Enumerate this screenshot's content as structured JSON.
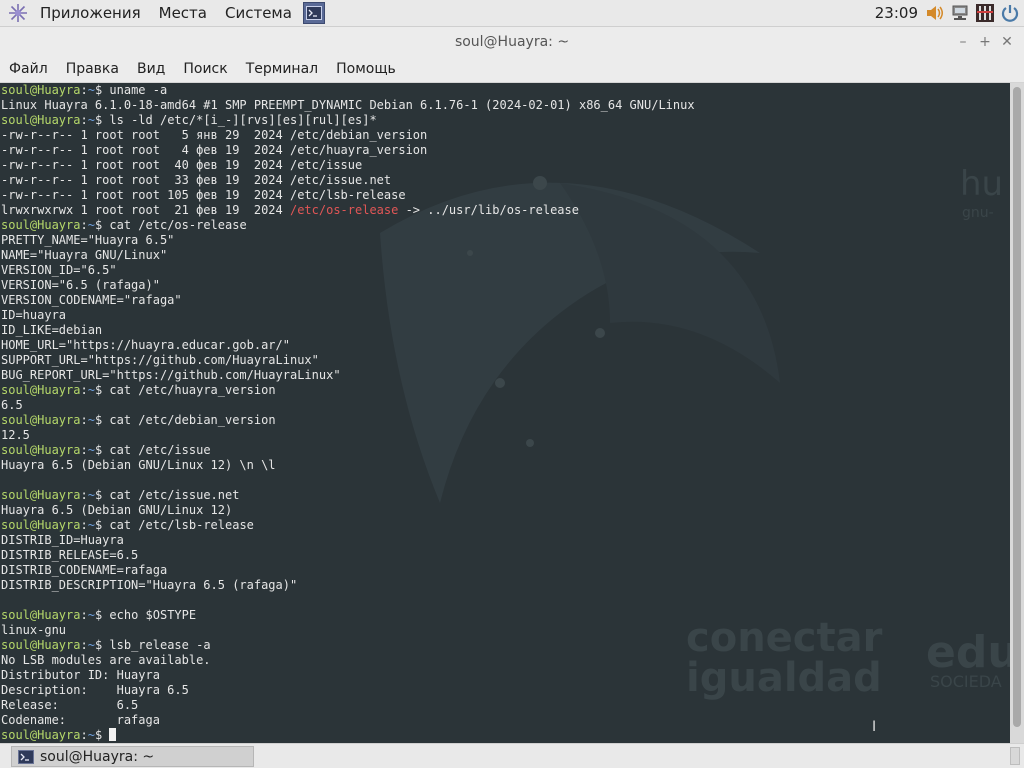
{
  "top_panel": {
    "menus": [
      "Приложения",
      "Места",
      "Система"
    ],
    "clock": "23:09",
    "tray_icons": [
      "volume-icon",
      "network-icon",
      "keyboard-icon",
      "power-icon"
    ]
  },
  "window": {
    "title": "soul@Huayra: ~",
    "controls": [
      "–",
      "+",
      "✕"
    ]
  },
  "menubar": [
    "Файл",
    "Правка",
    "Вид",
    "Поиск",
    "Терминал",
    "Помощь"
  ],
  "wallpaper_text": {
    "brand1": "conectar",
    "brand2": "igualdad",
    "brand3": "edu",
    "brand4": "SOCIEDA",
    "brand5": "hu",
    "brand6": "gnu-"
  },
  "colors": {
    "terminal_bg": "#2b3438",
    "prompt_user": "#b5d86a",
    "prompt_path": "#6fa0e0",
    "symlink": "#e05656"
  },
  "terminal": {
    "prompt_user": "soul@Huayra",
    "prompt_sep": ":",
    "prompt_path": "~",
    "prompt_end": "$ ",
    "lines": [
      {
        "type": "prompt",
        "text": "uname -a"
      },
      {
        "type": "out",
        "text": "Linux Huayra 6.1.0-18-amd64 #1 SMP PREEMPT_DYNAMIC Debian 6.1.76-1 (2024-02-01) x86_64 GNU/Linux"
      },
      {
        "type": "prompt",
        "text": "ls -ld /etc/*[i_-][rvs][es][rul][es]*"
      },
      {
        "type": "out",
        "text": "-rw-r--r-- 1 root root   5 янв 29  2024 /etc/debian_version"
      },
      {
        "type": "out",
        "text": "-rw-r--r-- 1 root root   4 фев 19  2024 /etc/huayra_version"
      },
      {
        "type": "out",
        "text": "-rw-r--r-- 1 root root  40 фев 19  2024 /etc/issue"
      },
      {
        "type": "out",
        "text": "-rw-r--r-- 1 root root  33 фев 19  2024 /etc/issue.net"
      },
      {
        "type": "out",
        "text": "-rw-r--r-- 1 root root 105 фев 19  2024 /etc/lsb-release"
      },
      {
        "type": "link",
        "pre": "lrwxrwxrwx 1 root root  21 фев 19  2024 ",
        "red": "/etc/os-release",
        "post": " -> ../usr/lib/os-release"
      },
      {
        "type": "prompt",
        "text": "cat /etc/os-release"
      },
      {
        "type": "out",
        "text": "PRETTY_NAME=\"Huayra 6.5\""
      },
      {
        "type": "out",
        "text": "NAME=\"Huayra GNU/Linux\""
      },
      {
        "type": "out",
        "text": "VERSION_ID=\"6.5\""
      },
      {
        "type": "out",
        "text": "VERSION=\"6.5 (rafaga)\""
      },
      {
        "type": "out",
        "text": "VERSION_CODENAME=\"rafaga\""
      },
      {
        "type": "out",
        "text": "ID=huayra"
      },
      {
        "type": "out",
        "text": "ID_LIKE=debian"
      },
      {
        "type": "out",
        "text": "HOME_URL=\"https://huayra.educar.gob.ar/\""
      },
      {
        "type": "out",
        "text": "SUPPORT_URL=\"https://github.com/HuayraLinux\""
      },
      {
        "type": "out",
        "text": "BUG_REPORT_URL=\"https://github.com/HuayraLinux\""
      },
      {
        "type": "prompt",
        "text": "cat /etc/huayra_version"
      },
      {
        "type": "out",
        "text": "6.5"
      },
      {
        "type": "prompt",
        "text": "cat /etc/debian_version"
      },
      {
        "type": "out",
        "text": "12.5"
      },
      {
        "type": "prompt",
        "text": "cat /etc/issue"
      },
      {
        "type": "out",
        "text": "Huayra 6.5 (Debian GNU/Linux 12) \\n \\l"
      },
      {
        "type": "out",
        "text": ""
      },
      {
        "type": "prompt",
        "text": "cat /etc/issue.net"
      },
      {
        "type": "out",
        "text": "Huayra 6.5 (Debian GNU/Linux 12)"
      },
      {
        "type": "prompt",
        "text": "cat /etc/lsb-release"
      },
      {
        "type": "out",
        "text": "DISTRIB_ID=Huayra"
      },
      {
        "type": "out",
        "text": "DISTRIB_RELEASE=6.5"
      },
      {
        "type": "out",
        "text": "DISTRIB_CODENAME=rafaga"
      },
      {
        "type": "out",
        "text": "DISTRIB_DESCRIPTION=\"Huayra 6.5 (rafaga)\""
      },
      {
        "type": "out",
        "text": ""
      },
      {
        "type": "prompt",
        "text": "echo $OSTYPE"
      },
      {
        "type": "out",
        "text": "linux-gnu"
      },
      {
        "type": "prompt",
        "text": "lsb_release -a"
      },
      {
        "type": "out",
        "text": "No LSB modules are available."
      },
      {
        "type": "out",
        "text": "Distributor ID:\tHuayra"
      },
      {
        "type": "out",
        "text": "Description:\tHuayra 6.5"
      },
      {
        "type": "out",
        "text": "Release:\t6.5"
      },
      {
        "type": "out",
        "text": "Codename:\trafaga"
      },
      {
        "type": "cursor",
        "text": ""
      }
    ]
  },
  "taskbar": {
    "item_label": "soul@Huayra: ~"
  }
}
